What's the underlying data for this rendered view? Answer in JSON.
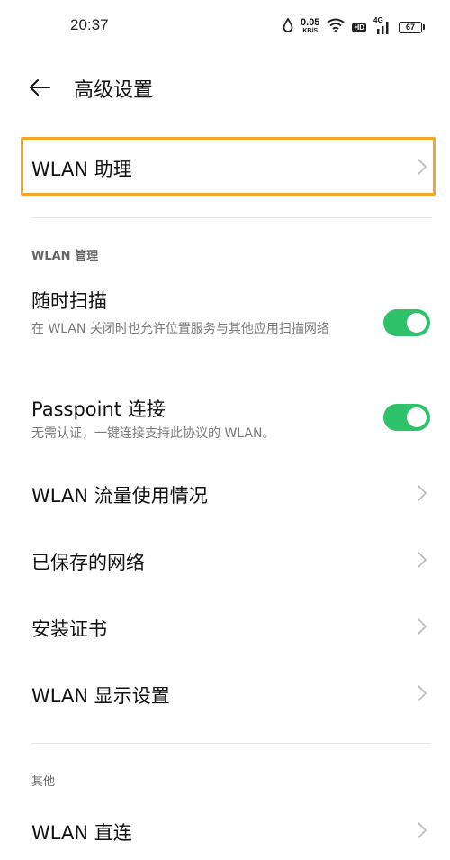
{
  "status_bar": {
    "time": "20:37",
    "net_speed_value": "0.05",
    "net_speed_unit": "KB/S",
    "hd_label": "HD",
    "network_label": "4G",
    "battery_level": "67"
  },
  "header": {
    "back_icon": "arrow-left-icon",
    "title": "高级设置"
  },
  "items": {
    "wlan_assistant": {
      "label": "WLAN 助理",
      "icon": "chevron-right-icon"
    },
    "wlan_section_header": "WLAN 管理",
    "always_scan": {
      "label": "随时扫描",
      "description": "在 WLAN 关闭时也允许位置服务与其他应用扫描网络",
      "enabled": true
    },
    "passpoint": {
      "label": "Passpoint 连接",
      "description": "无需认证，一键连接支持此协议的 WLAN。",
      "enabled": true
    },
    "data_usage": {
      "label": "WLAN 流量使用情况",
      "icon": "chevron-right-icon"
    },
    "saved_networks": {
      "label": "已保存的网络",
      "icon": "chevron-right-icon"
    },
    "install_certificates": {
      "label": "安装证书",
      "icon": "chevron-right-icon"
    },
    "display_settings": {
      "label": "WLAN 显示设置",
      "icon": "chevron-right-icon"
    },
    "other_section_header": "其他",
    "wlan_direct": {
      "label": "WLAN 直连",
      "icon": "chevron-right-icon"
    }
  },
  "colors": {
    "toggle_on": "#2ec36b",
    "focus_outline": "#f5a623",
    "chevron": "#bdbdbd"
  }
}
